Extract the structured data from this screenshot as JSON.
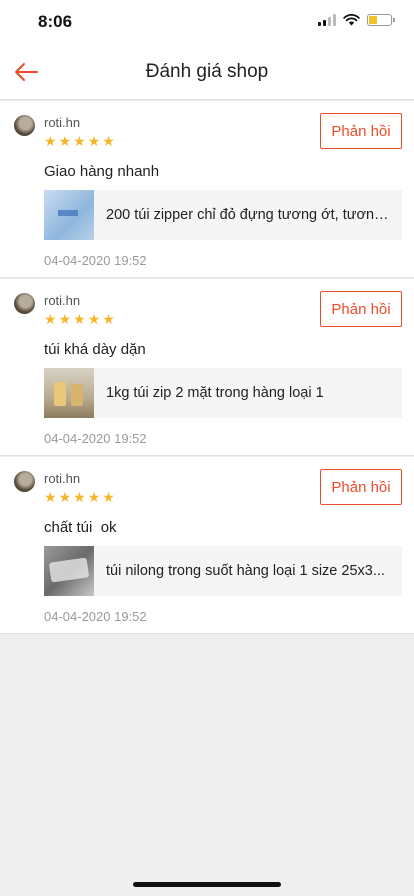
{
  "status_bar": {
    "time": "8:06",
    "battery_level": 0.4
  },
  "header": {
    "title": "Đánh giá shop"
  },
  "colors": {
    "accent": "#ee4d2d",
    "star": "#f5b62b",
    "muted": "#9a9a9a"
  },
  "reviews": [
    {
      "username": "roti.hn",
      "rating": 5,
      "reply_label": "Phản hồi",
      "comment": "Giao hàng nhanh",
      "product_name": "200 túi zipper chỉ đỏ đựng tương ớt, tương...",
      "date": "04-04-2020 19:52"
    },
    {
      "username": "roti.hn",
      "rating": 5,
      "reply_label": "Phản hồi",
      "comment": "túi khá dày dặn",
      "product_name": "1kg túi zip 2 mặt trong hàng loại 1",
      "date": "04-04-2020 19:52"
    },
    {
      "username": "roti.hn",
      "rating": 5,
      "reply_label": "Phản hồi",
      "comment": "chất túi  ok",
      "product_name": "túi nilong trong suốt hàng loại 1 size 25x3...",
      "date": "04-04-2020 19:52"
    }
  ]
}
